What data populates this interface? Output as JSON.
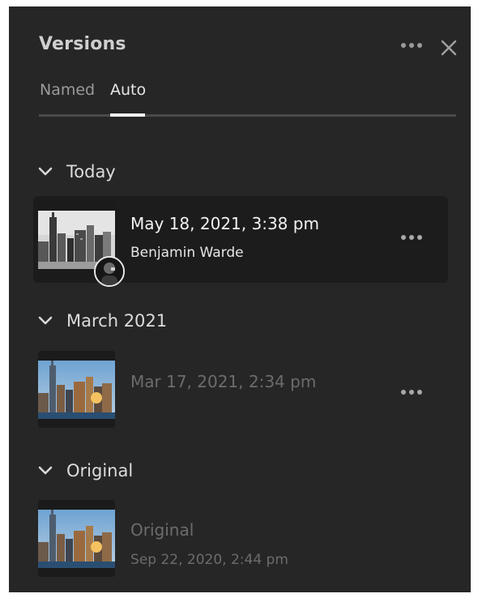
{
  "panel": {
    "title": "Versions",
    "more_icon": "more-horizontal-icon",
    "close_icon": "close-icon"
  },
  "tabs": [
    {
      "label": "Named",
      "active": false
    },
    {
      "label": "Auto",
      "active": true
    }
  ],
  "groups": [
    {
      "label": "Today",
      "versions": [
        {
          "date": "May 18, 2021, 3:38 pm",
          "author": "Benjamin Warde",
          "selected": true,
          "thumbnail": "black-and-white-city-skyline",
          "has_avatar": true
        }
      ]
    },
    {
      "label": "March 2021",
      "versions": [
        {
          "date": "Mar 17, 2021, 2:34 pm",
          "selected": false,
          "thumbnail": "color-city-skyline-sunset"
        }
      ]
    },
    {
      "label": "Original",
      "versions": [
        {
          "name": "Original",
          "date": "Sep 22, 2020, 2:44 pm",
          "selected": false,
          "thumbnail": "color-city-skyline-sunset"
        }
      ]
    }
  ],
  "colors": {
    "panel_bg": "#262626",
    "selected_row_bg": "#1c1c1c",
    "active_tab": "#f0f0f0",
    "dim_text": "#6c6c6c"
  }
}
